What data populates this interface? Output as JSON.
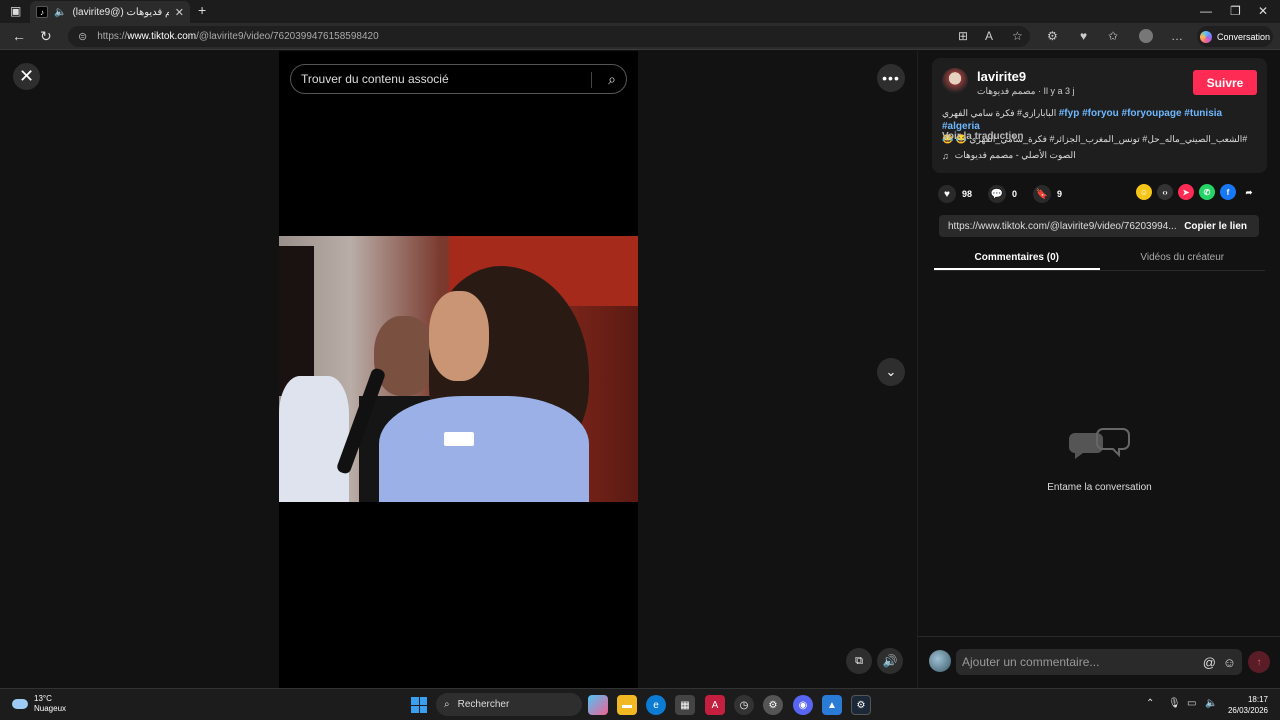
{
  "browser": {
    "tab_title": "(lavirite9@) مصمم فديوهات",
    "url_prefix": "https://",
    "url_host": "www.tiktok.com",
    "url_path": "/@lavirite9/video/7620399476158598420",
    "conversation_label": "Conversation"
  },
  "search": {
    "placeholder": "Trouver du contenu associé"
  },
  "post": {
    "username": "lavirite9",
    "subtitle": "مصمم فديوهات · Il y a 3 j",
    "follow_label": "Suivre",
    "description_arabic": "البابارازي# فكرة سامي الفهري",
    "hashtags": "#fyp #foryou #foryoupage #tunisia #algeria",
    "description_line2": "😂 😂 الشعب_الصيني_ماله_حل# تونس_المغرب_الجزائر# فكرة_سامي_الفهري#",
    "translate_label": "Voir la traduction",
    "sound": "الصوت الأصلي - مصمم فديوهات"
  },
  "actions": {
    "likes": "98",
    "comments": "0",
    "saves": "9"
  },
  "link": {
    "url": "https://www.tiktok.com/@lavirite9/video/76203994...",
    "copy_label": "Copier le lien"
  },
  "tabs": {
    "comments": "Commentaires (0)",
    "creator_videos": "Vidéos du créateur"
  },
  "empty_state": "Entame la conversation",
  "composer": {
    "placeholder": "Ajouter un commentaire..."
  },
  "taskbar": {
    "temperature": "13°C",
    "weather": "Nuageux",
    "search_label": "Rechercher",
    "time": "18:17",
    "date": "26/03/2026"
  },
  "colors": {
    "accent": "#fe2c55",
    "hashtag": "#6fb8ff"
  }
}
